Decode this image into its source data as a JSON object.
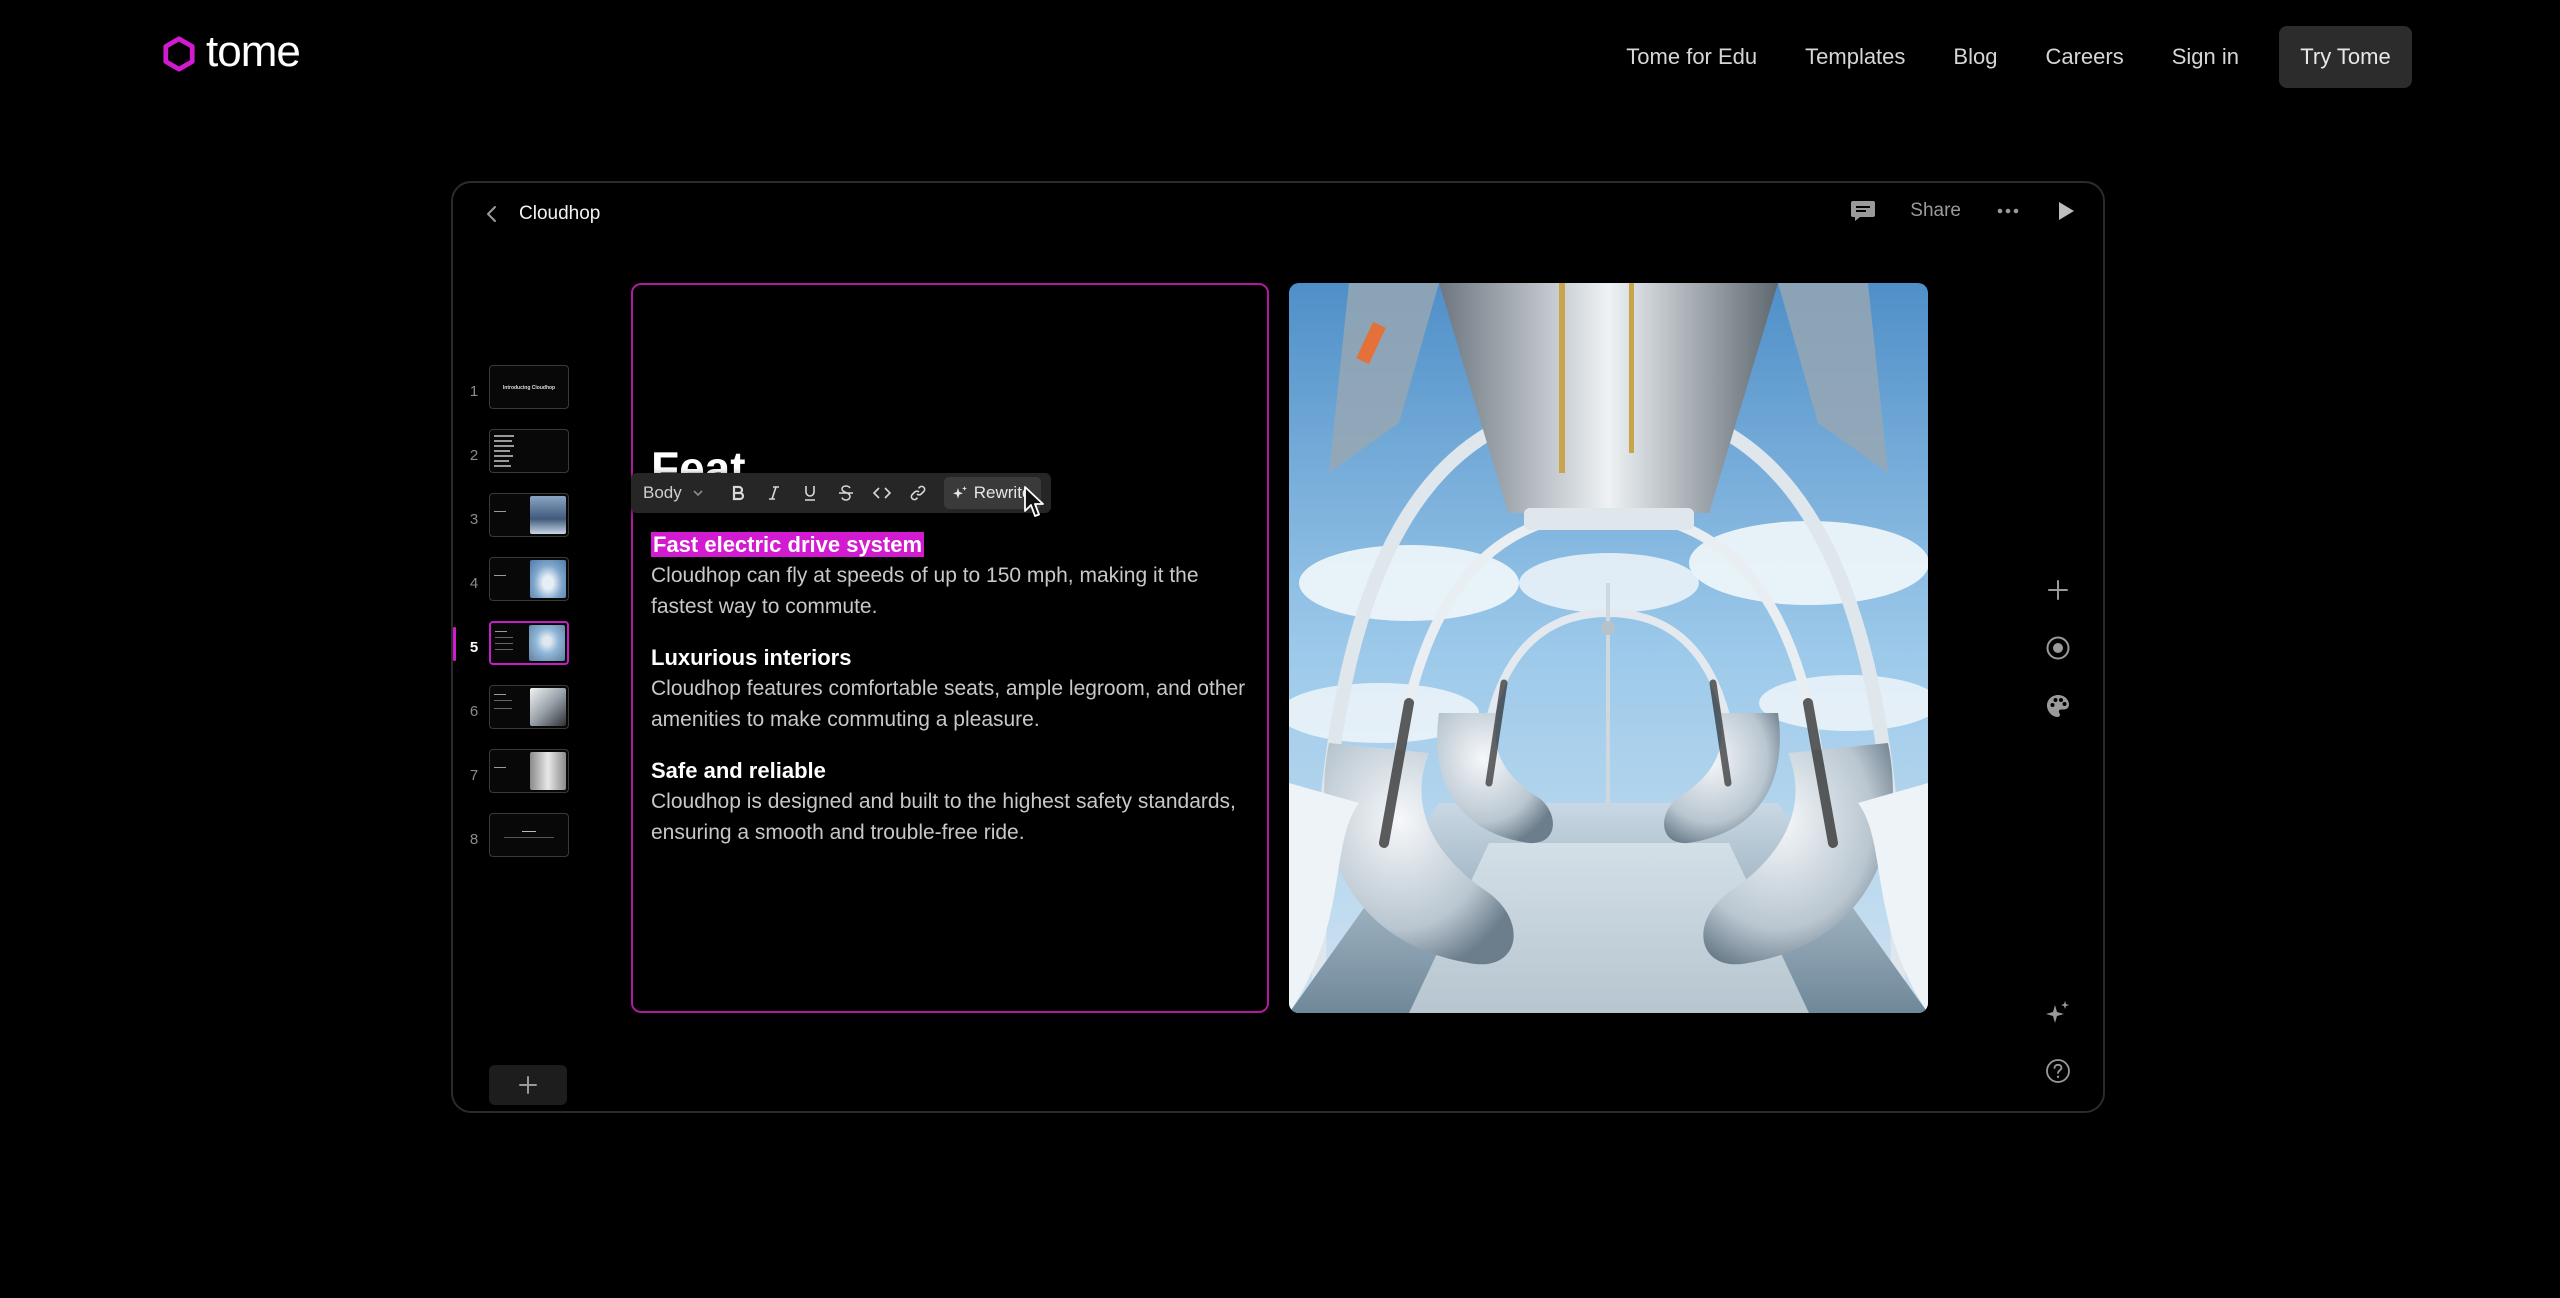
{
  "brand": {
    "name": "tome",
    "accent": "#d21bd0"
  },
  "nav": {
    "links": [
      "Tome for Edu",
      "Templates",
      "Blog",
      "Careers",
      "Sign in"
    ],
    "cta": "Try Tome"
  },
  "editor": {
    "doc_title": "Cloudhop",
    "header": {
      "share_label": "Share"
    },
    "slides": [
      {
        "number": "1",
        "thumb_text": "Introducing Cloudhop"
      },
      {
        "number": "2",
        "thumb_text": ""
      },
      {
        "number": "3",
        "thumb_text": ""
      },
      {
        "number": "4",
        "thumb_text": ""
      },
      {
        "number": "5",
        "thumb_text": ""
      },
      {
        "number": "6",
        "thumb_text": ""
      },
      {
        "number": "7",
        "thumb_text": ""
      },
      {
        "number": "8",
        "thumb_text": ""
      }
    ],
    "active_slide": "5",
    "card": {
      "ghost_title": "Feat",
      "toolbar": {
        "style_select": "Body",
        "buttons": [
          "bold",
          "italic",
          "underline",
          "strikethrough",
          "code",
          "link"
        ],
        "rewrite_label": "Rewrite"
      },
      "features": [
        {
          "title": "Fast electric drive system",
          "description": "Cloudhop can fly at speeds of up to 150 mph, making it the fastest way to commute."
        },
        {
          "title": "Luxurious interiors",
          "description": "Cloudhop features comfortable seats, ample legroom, and other amenities to make commuting a pleasure."
        },
        {
          "title": "Safe and reliable",
          "description": "Cloudhop is designed and built to the highest safety standards, ensuring a smooth and trouble-free ride."
        }
      ]
    },
    "right_tools": [
      "plus-icon",
      "record-icon",
      "palette-icon",
      "sparkle-icon",
      "help-icon"
    ]
  }
}
